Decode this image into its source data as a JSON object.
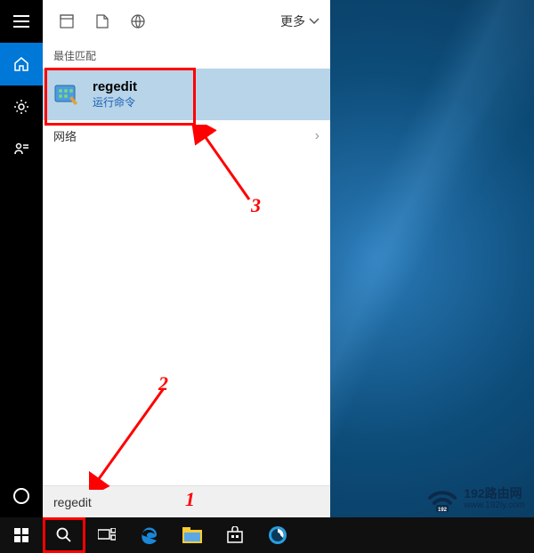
{
  "header": {
    "more_label": "更多"
  },
  "sections": {
    "best_match": "最佳匹配",
    "network": "网络"
  },
  "result": {
    "title": "regedit",
    "subtitle": "运行命令"
  },
  "search": {
    "value": "regedit",
    "placeholder": ""
  },
  "annotations": {
    "n1": "1",
    "n2": "2",
    "n3": "3"
  },
  "logo": {
    "line1": "192路由网",
    "line2": "www.192ly.com"
  }
}
